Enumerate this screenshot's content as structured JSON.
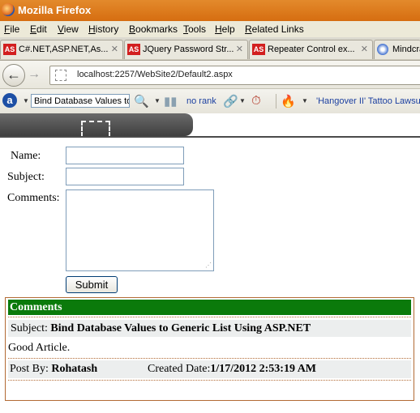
{
  "window": {
    "title": "Mozilla Firefox"
  },
  "menu": [
    "File",
    "Edit",
    "View",
    "History",
    "Bookmarks",
    "Tools",
    "Help",
    "Related Links"
  ],
  "tabs": [
    {
      "label": "C#.NET,ASP.NET,As...",
      "icon": "AS"
    },
    {
      "label": "JQuery Password Str...",
      "icon": "AS"
    },
    {
      "label": "Repeater Control ex...",
      "icon": "AS"
    },
    {
      "label": "Mindcra",
      "icon": "globe"
    }
  ],
  "nav": {
    "url": "localhost:2257/WebSite2/Default2.aspx"
  },
  "toolbar": {
    "search_value": "Bind Database Values to",
    "rank_label": "no rank",
    "news_label": "'Hangover II' Tattoo Lawsu"
  },
  "form": {
    "name_label": "Name:",
    "subject_label": "Subject:",
    "comments_label": "Comments:",
    "name_value": "",
    "subject_value": "",
    "comments_value": "",
    "submit_label": "Submit"
  },
  "comments": {
    "header": "Comments",
    "subject_prefix": "Subject:",
    "subject": "Bind Database Values to Generic List Using ASP.NET",
    "body": "Good Article.",
    "post_by_prefix": "Post By:",
    "author": "Rohatash",
    "created_prefix": "Created Date:",
    "created": "1/17/2012 2:53:19 AM"
  },
  "colors": {
    "title_bar": "#d66d10",
    "comments_header": "#0b7a0b",
    "panel_border": "#b26a34"
  }
}
